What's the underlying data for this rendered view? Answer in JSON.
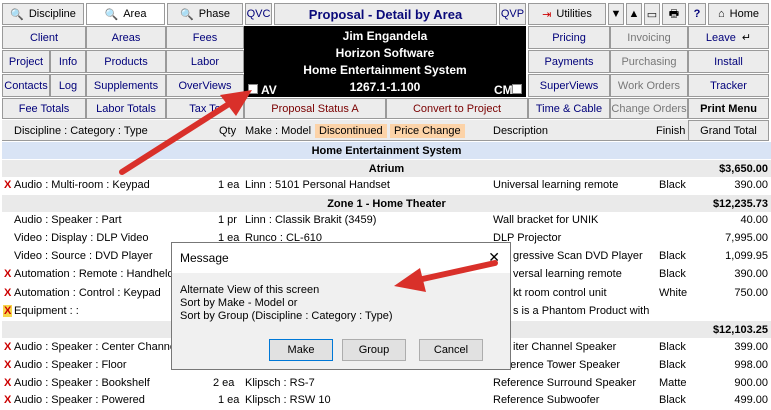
{
  "toolbar": {
    "discipline": "Discipline",
    "area": "Area",
    "phase": "Phase",
    "qvc": "QVC",
    "qvp": "QVP",
    "utilities": "Utilities",
    "help": "?",
    "home": "Home"
  },
  "title": "Proposal - Detail by Area",
  "left_buttons": [
    "Client",
    "Areas",
    "Fees",
    "Project",
    "Info",
    "Products",
    "Labor",
    "Contacts",
    "Log",
    "Supplements",
    "OverViews"
  ],
  "right_buttons": [
    "Pricing",
    "Invoicing",
    "Leave",
    "Payments",
    "Purchasing",
    "Install",
    "SuperViews",
    "Work Orders",
    "Tracker"
  ],
  "info": {
    "line1": "Jim Engandela",
    "line2": "Horizon Software",
    "line3": "Home Entertainment System",
    "id": "1267.1-1.100",
    "av": "AV",
    "cm": "CM"
  },
  "row4": {
    "fee_totals": "Fee Totals",
    "labor_totals": "Labor Totals",
    "tax_totals": "Tax To",
    "status": "Proposal Status A",
    "convert": "Convert to Project",
    "time_cable": "Time & Cable",
    "change_orders": "Change Orders",
    "print_menu": "Print Menu"
  },
  "columns": {
    "dct": "Discipline : Category : Type",
    "qty": "Qty",
    "make_model": "Make : Model",
    "discontinued": "Discontinued",
    "price_change": "Price Change",
    "description": "Description",
    "finish": "Finish",
    "grand_total": "Grand Total"
  },
  "sections": {
    "system": "Home Entertainment System",
    "atrium": "Atrium",
    "atrium_total": "$3,650.00",
    "zone1": "Zone 1 - Home Theater",
    "zone1_total": "$12,235.73",
    "zone2_total": "$12,103.25"
  },
  "rows": [
    {
      "dct": "Audio : Multi-room : Keypad",
      "qty": "1 ea",
      "make": "Linn : 5101 Personal Handset",
      "desc": "Universal learning remote",
      "finish": "Black",
      "price": "390.00",
      "mark": "X"
    },
    {
      "dct": "Audio : Speaker : Part",
      "qty": "1 pr",
      "make": "Linn : Classik Brakit (3459)",
      "desc": "Wall bracket for UNIK",
      "finish": "",
      "price": "40.00",
      "mark": ""
    },
    {
      "dct": "Video : Display : DLP Video",
      "qty": "1 ea",
      "make": "Runco : CL-610",
      "desc": "DLP Projector",
      "finish": "",
      "price": "7,995.00",
      "mark": ""
    },
    {
      "dct": "Video : Source : DVD Player",
      "qty": "",
      "make": "",
      "desc": "gressive Scan DVD Player",
      "finish": "Black",
      "price": "1,099.95",
      "mark": ""
    },
    {
      "dct": "Automation : Remote : Handheld",
      "qty": "",
      "make": "",
      "desc": "versal learning remote",
      "finish": "Black",
      "price": "390.00",
      "mark": "X"
    },
    {
      "dct": "Automation : Control : Keypad",
      "qty": "",
      "make": "",
      "desc": "kt room control unit",
      "finish": "White",
      "price": "750.00",
      "mark": "X"
    },
    {
      "dct": "Equipment :  :",
      "qty": "",
      "make": "",
      "desc": "s is a Phantom Product with",
      "finish": "",
      "price": "",
      "mark": "XB"
    },
    {
      "dct": "Audio : Speaker : Center Channe",
      "qty": "",
      "make": "",
      "desc": "iter Channel Speaker",
      "finish": "Black",
      "price": "399.00",
      "mark": "X"
    },
    {
      "dct": "Audio : Speaker : Floor",
      "qty": "",
      "make": "",
      "desc": "Reference Tower Speaker",
      "finish": "Black",
      "price": "998.00",
      "mark": "X"
    },
    {
      "dct": "Audio : Speaker : Bookshelf",
      "qty": "2 ea",
      "make": "Klipsch : RS-7",
      "desc": "Reference Surround Speaker",
      "finish": "Matte",
      "price": "900.00",
      "mark": "X"
    },
    {
      "dct": "Audio : Speaker : Powered",
      "qty": "1 ea",
      "make": "Klipsch : RSW 10",
      "desc": "Reference Subwoofer",
      "finish": "Black",
      "price": "499.00",
      "mark": "X"
    }
  ],
  "dialog": {
    "title": "Message",
    "close": "✕",
    "line1": "Alternate View of this screen",
    "line2": "Sort by Make - Model or",
    "line3": "Sort by Group (Discipline : Category : Type)",
    "make": "Make",
    "group": "Group",
    "cancel": "Cancel"
  },
  "colors": {
    "arrow": "#d9302a",
    "section": "#d9e4f5",
    "highlight": "#fcd3a8"
  }
}
